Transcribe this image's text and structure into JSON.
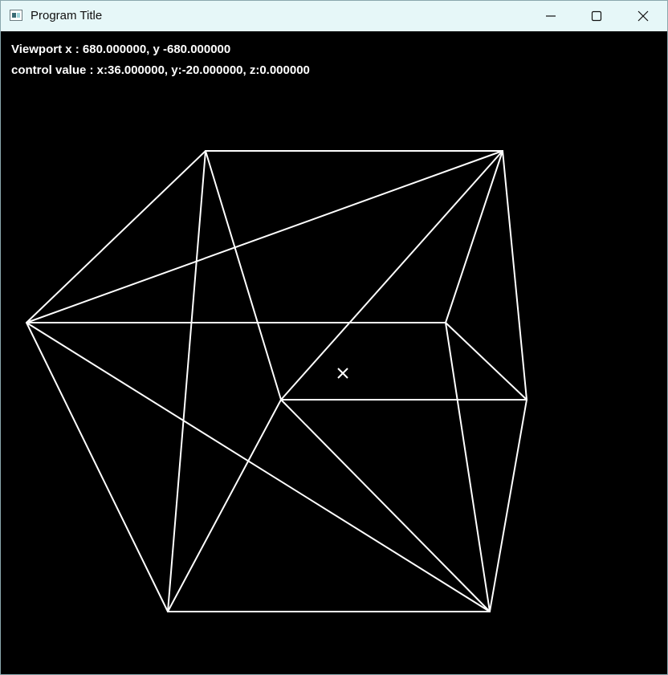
{
  "window": {
    "title": "Program Title",
    "controls": {
      "minimize": "minimize-icon",
      "maximize": "maximize-icon",
      "close": "close-icon"
    }
  },
  "hud": {
    "viewport_text": "Viewport x : 680.000000, y -680.000000",
    "control_text": "control value : x:36.000000, y:-20.000000, z:0.000000"
  },
  "scene": {
    "background": "#000000",
    "line_color": "#ffffff",
    "marker_icon": "x-marker-icon"
  }
}
